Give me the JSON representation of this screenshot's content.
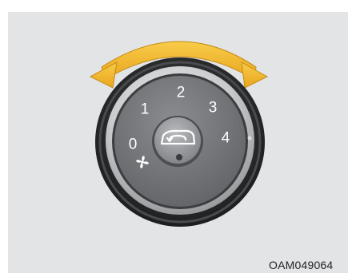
{
  "dial": {
    "positions": [
      "0",
      "1",
      "2",
      "3",
      "4"
    ],
    "fan_symbol": "fan-icon",
    "center_symbol": "recirculation-icon"
  },
  "figure_code": "OAM049064",
  "colors": {
    "arrow": "#f2b830",
    "knob_face": "#737579",
    "outer_ring": "#2b2c2e",
    "background": "#e3e4e6"
  }
}
